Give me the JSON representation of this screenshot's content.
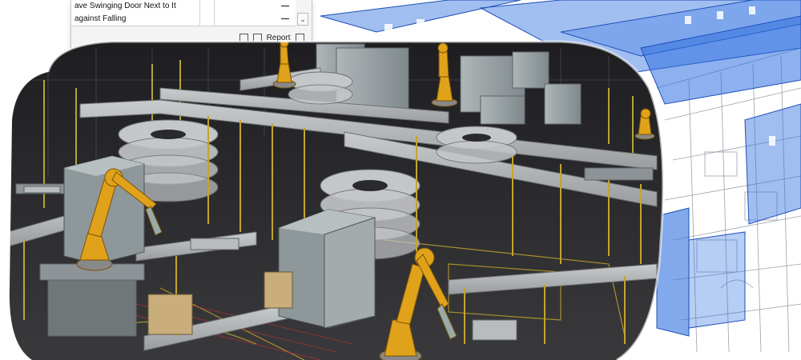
{
  "panel": {
    "rows": [
      {
        "label": "ave Swinging Door Next to It",
        "mark": "—"
      },
      {
        "label": "against Falling",
        "mark": "—"
      }
    ],
    "chevron": "⌄",
    "report_label": "Report"
  },
  "icons": [
    "warning-icon",
    "copy-icon",
    "export-icon",
    "report-icon",
    "window-icon"
  ],
  "colors": {
    "blueprint_blue": "#2f6fe0",
    "robot_yellow": "#e0a21a",
    "floor_dark": "#2c2c2e",
    "cabinet_gray": "#9aa3a6",
    "warning_red": "#d03030"
  }
}
